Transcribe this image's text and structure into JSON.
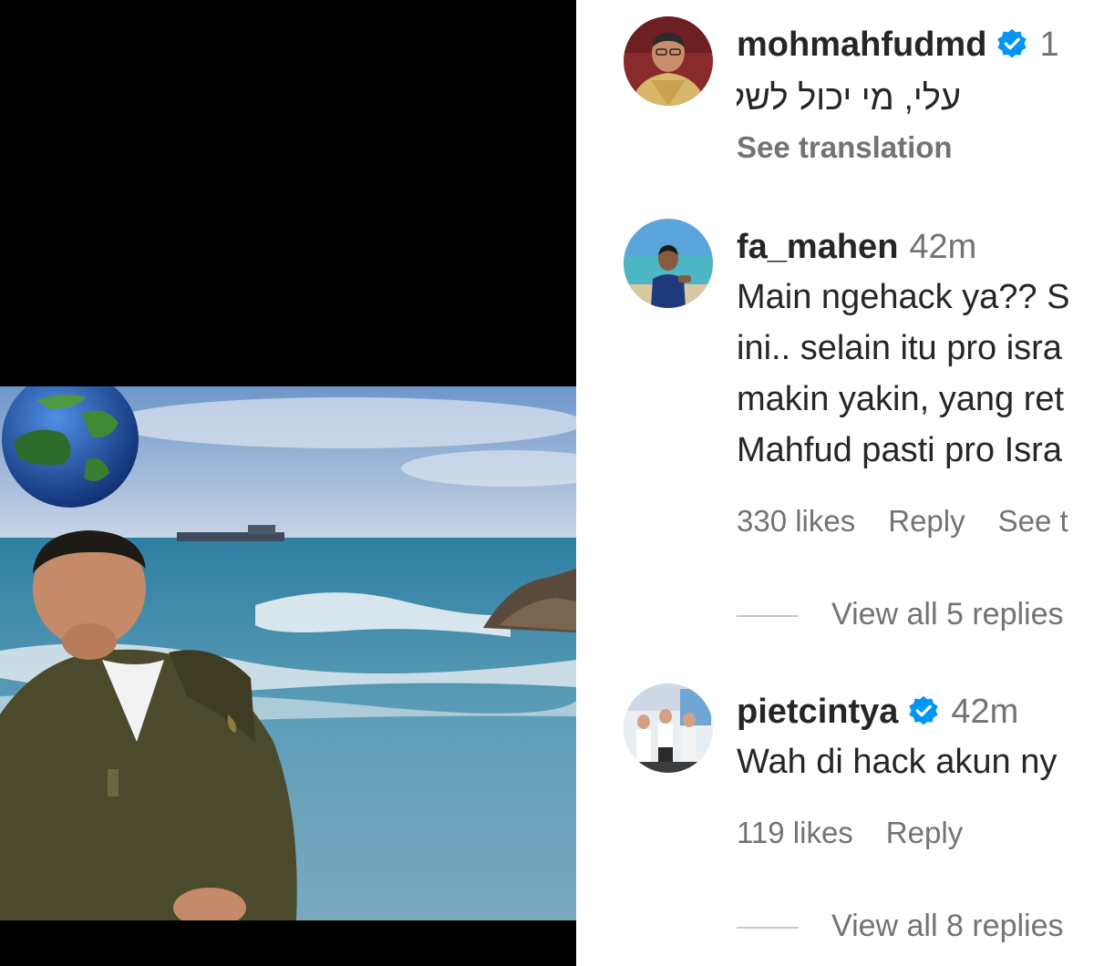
{
  "comments": [
    {
      "username": "mohmahfudmd",
      "verified": true,
      "time": "1",
      "text": "עלי, מי יכול לשלוט בי",
      "translation_label": "See translation"
    },
    {
      "username": "fa_mahen",
      "verified": false,
      "time": "42m",
      "lines": [
        "Main ngehack ya?? S",
        "ini.. selain itu pro isra",
        "makin yakin, yang ret",
        "Mahfud pasti pro Isra"
      ],
      "likes": "330 likes",
      "reply": "Reply",
      "see_translation": "See t",
      "view_replies": "View all 5 replies"
    },
    {
      "username": "pietcintya",
      "verified": true,
      "time": "42m",
      "text": "Wah di hack akun ny",
      "likes": "119 likes",
      "reply": "Reply",
      "view_replies": "View all 8 replies"
    }
  ],
  "icons": {
    "verified": "verified-badge-icon"
  },
  "colors": {
    "verified_blue": "#0095f6",
    "secondary_text": "#737373",
    "primary_text": "#262626"
  }
}
